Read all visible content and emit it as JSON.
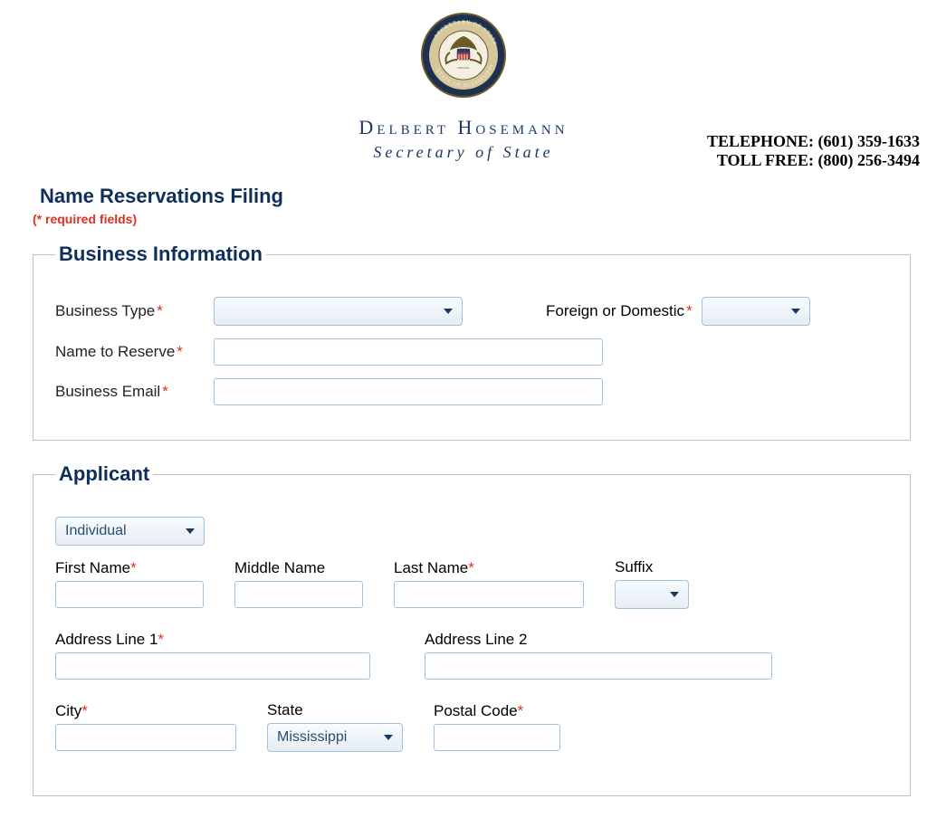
{
  "header": {
    "seal_outer_text": "SECRETARY OF STATE — STATE OF MISSISSIPPI",
    "official_name": "Delbert Hosemann",
    "official_title": "Secretary of State",
    "contact": {
      "telephone_label": "TELEPHONE:",
      "telephone_number": "(601) 359-1633",
      "tollfree_label": "TOLL FREE:",
      "tollfree_number": "(800) 256-3494"
    }
  },
  "form": {
    "title": "Name Reservations Filing",
    "required_note": "(* required fields)",
    "business_info": {
      "legend": "Business Information",
      "business_type_label": "Business Type",
      "business_type_value": "",
      "foreign_domestic_label": "Foreign or Domestic",
      "foreign_domestic_value": "",
      "name_to_reserve_label": "Name to Reserve",
      "name_to_reserve_value": "",
      "business_email_label": "Business Email",
      "business_email_value": ""
    },
    "applicant": {
      "legend": "Applicant",
      "entity_type_value": "Individual",
      "first_name_label": "First Name",
      "first_name_value": "",
      "middle_name_label": "Middle Name",
      "middle_name_value": "",
      "last_name_label": "Last Name",
      "last_name_value": "",
      "suffix_label": "Suffix",
      "suffix_value": "",
      "address1_label": "Address Line 1",
      "address1_value": "",
      "address2_label": "Address Line 2",
      "address2_value": "",
      "city_label": "City",
      "city_value": "",
      "state_label": "State",
      "state_value": "Mississippi",
      "postal_label": "Postal Code",
      "postal_value": ""
    }
  }
}
